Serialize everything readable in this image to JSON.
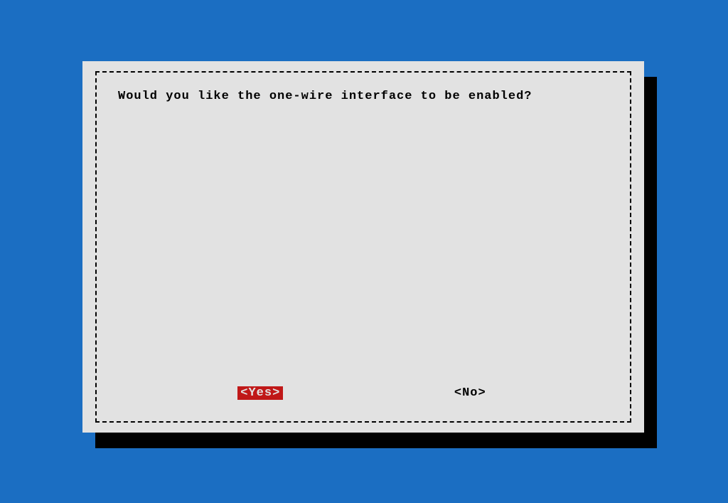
{
  "dialog": {
    "message": "Would you like the one-wire interface to be enabled?",
    "buttons": {
      "yes_label": "<Yes>",
      "no_label": "<No>"
    }
  },
  "colors": {
    "background": "#1b6ec2",
    "dialog_bg": "#e2e2e2",
    "shadow": "#000000",
    "selected_bg": "#c01818",
    "text": "#000000"
  }
}
